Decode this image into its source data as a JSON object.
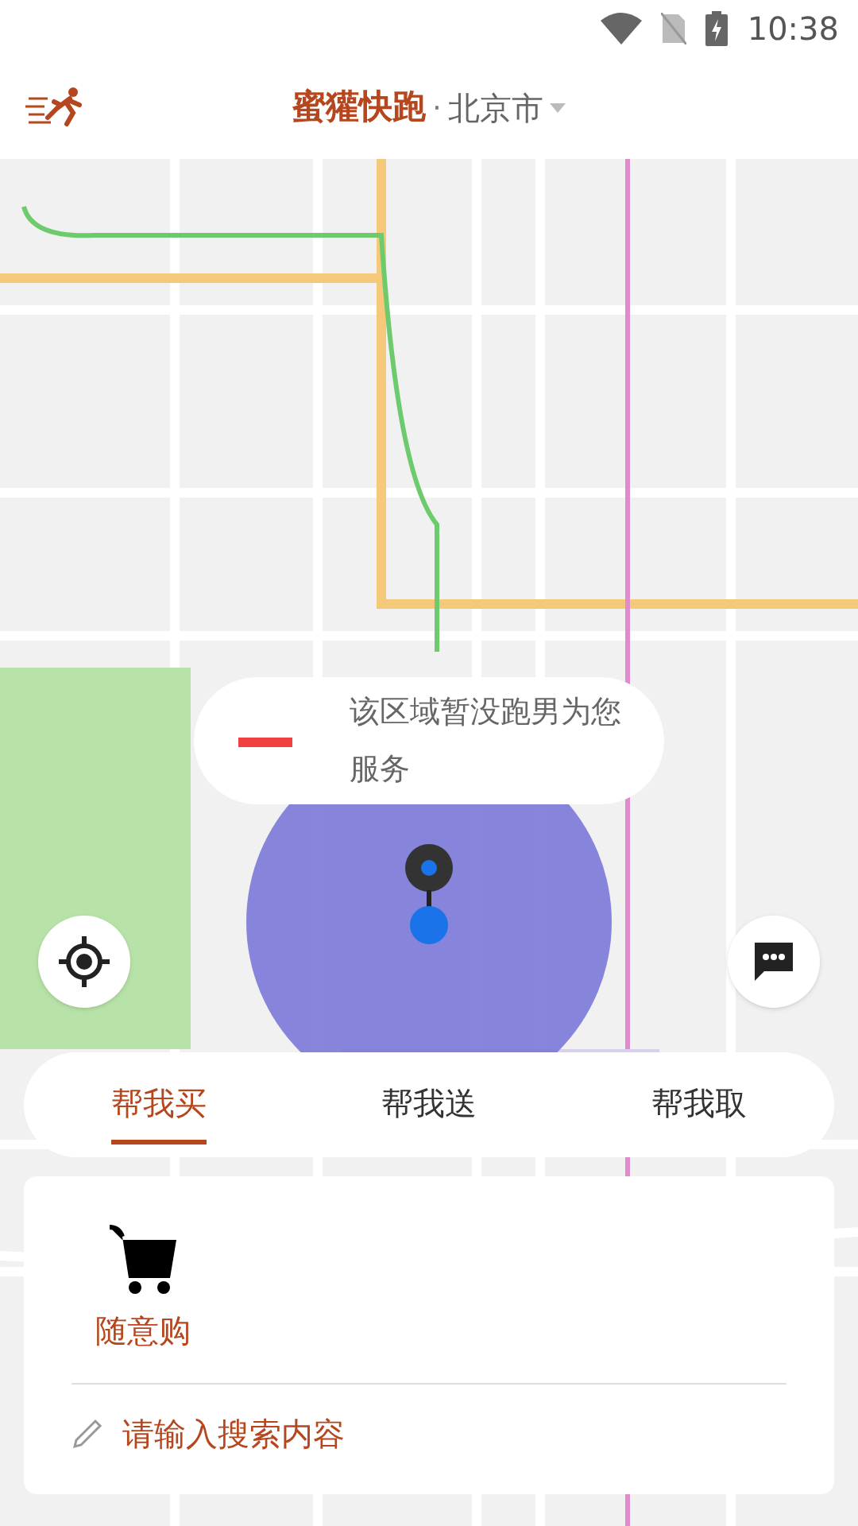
{
  "status_bar": {
    "time": "10:38"
  },
  "header": {
    "app_name": "蜜獾快跑",
    "separator": "·",
    "city": "北京市"
  },
  "map": {
    "notice": "该区域暂没跑男为您服务"
  },
  "tabs": [
    {
      "label": "帮我买",
      "selected": true
    },
    {
      "label": "帮我送",
      "selected": false
    },
    {
      "label": "帮我取",
      "selected": false
    }
  ],
  "panel": {
    "category": "随意购",
    "search": {
      "placeholder": "请输入搜索内容"
    }
  }
}
